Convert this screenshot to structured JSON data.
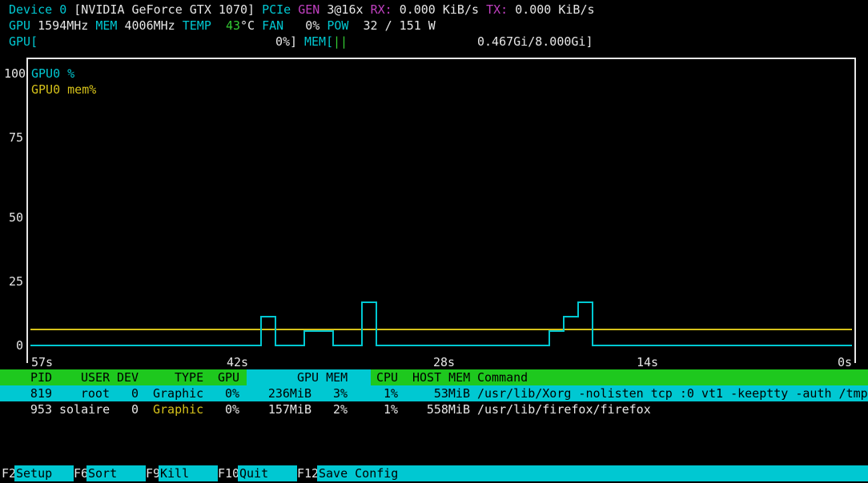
{
  "device": {
    "label": "Device 0",
    "name": "[NVIDIA GeForce GTX 1070]",
    "pcie_label": "PCIe",
    "gen_label": "GEN",
    "gen_value": "3@16x",
    "rx_label": "RX:",
    "rx_value": "0.000 KiB/s",
    "tx_label": "TX:",
    "tx_value": "0.000 KiB/s"
  },
  "stats": {
    "gpu_label": "GPU",
    "gpu_clock": "1594MHz",
    "mem_label": "MEM",
    "mem_clock": "4006MHz",
    "temp_label": "TEMP",
    "temp_value": "43",
    "temp_unit": "°C",
    "fan_label": "FAN",
    "fan_value": "0%",
    "pow_label": "POW",
    "pow_value": "32 / 151 W"
  },
  "bars": {
    "gpu_open": "GPU[",
    "gpu_close": "0%]",
    "gpu_util": 0,
    "mem_open": "MEM[",
    "mem_fill": "||",
    "mem_close": "0.467Gi/8.000Gi]",
    "mem_used_fraction": 0.058
  },
  "chart_data": {
    "type": "line",
    "y_ticks": [
      "100",
      "75",
      "50",
      "25",
      "0"
    ],
    "ylim": [
      0,
      100
    ],
    "x_ticks": [
      "57s",
      "42s",
      "28s",
      "14s",
      "0s"
    ],
    "xlim": [
      57,
      0
    ],
    "legend": [
      {
        "name": "GPU0 %",
        "color": "#00c8d2"
      },
      {
        "name": "GPU0 mem%",
        "color": "#d6c21a"
      }
    ],
    "series": [
      {
        "name": "GPU0 %",
        "color": "#00c8d2",
        "points": [
          [
            57,
            0
          ],
          [
            41,
            0
          ],
          [
            41,
            10
          ],
          [
            40,
            10
          ],
          [
            40,
            0
          ],
          [
            38,
            0
          ],
          [
            38,
            5
          ],
          [
            36,
            5
          ],
          [
            36,
            0
          ],
          [
            34,
            0
          ],
          [
            34,
            15
          ],
          [
            33,
            15
          ],
          [
            33,
            0
          ],
          [
            21,
            0
          ],
          [
            21,
            5
          ],
          [
            20,
            5
          ],
          [
            20,
            10
          ],
          [
            19,
            10
          ],
          [
            19,
            15
          ],
          [
            18,
            15
          ],
          [
            18,
            0
          ],
          [
            0,
            0
          ]
        ]
      },
      {
        "name": "GPU0 mem%",
        "color": "#d6c21a",
        "points": [
          [
            57,
            5
          ],
          [
            0,
            5
          ]
        ]
      }
    ]
  },
  "processes": {
    "headers": {
      "pid": "PID",
      "user": "USER",
      "dev": "DEV",
      "type": "TYPE",
      "gpu": "GPU",
      "gpu_mem": "GPU MEM",
      "cpu": "CPU",
      "host_mem": "HOST MEM",
      "command": "Command"
    },
    "rows": [
      {
        "pid": "819",
        "user": "root",
        "dev": "0",
        "type": "Graphic",
        "gpu": "0%",
        "gpu_mem": "236MiB",
        "gpu_mem_pct": "3%",
        "cpu": "1%",
        "host_mem": "53MiB",
        "command": "/usr/lib/Xorg -nolisten tcp :0 vt1 -keeptty -auth /tmp"
      },
      {
        "pid": "953",
        "user": "solaire",
        "dev": "0",
        "type": "Graphic",
        "gpu": "0%",
        "gpu_mem": "157MiB",
        "gpu_mem_pct": "2%",
        "cpu": "1%",
        "host_mem": "558MiB",
        "command": "/usr/lib/firefox/firefox"
      }
    ]
  },
  "function_keys": [
    {
      "key": "F2",
      "label": "Setup"
    },
    {
      "key": "F6",
      "label": "Sort"
    },
    {
      "key": "F9",
      "label": "Kill"
    },
    {
      "key": "F10",
      "label": "Quit"
    },
    {
      "key": "F12",
      "label": "Save Config"
    }
  ]
}
